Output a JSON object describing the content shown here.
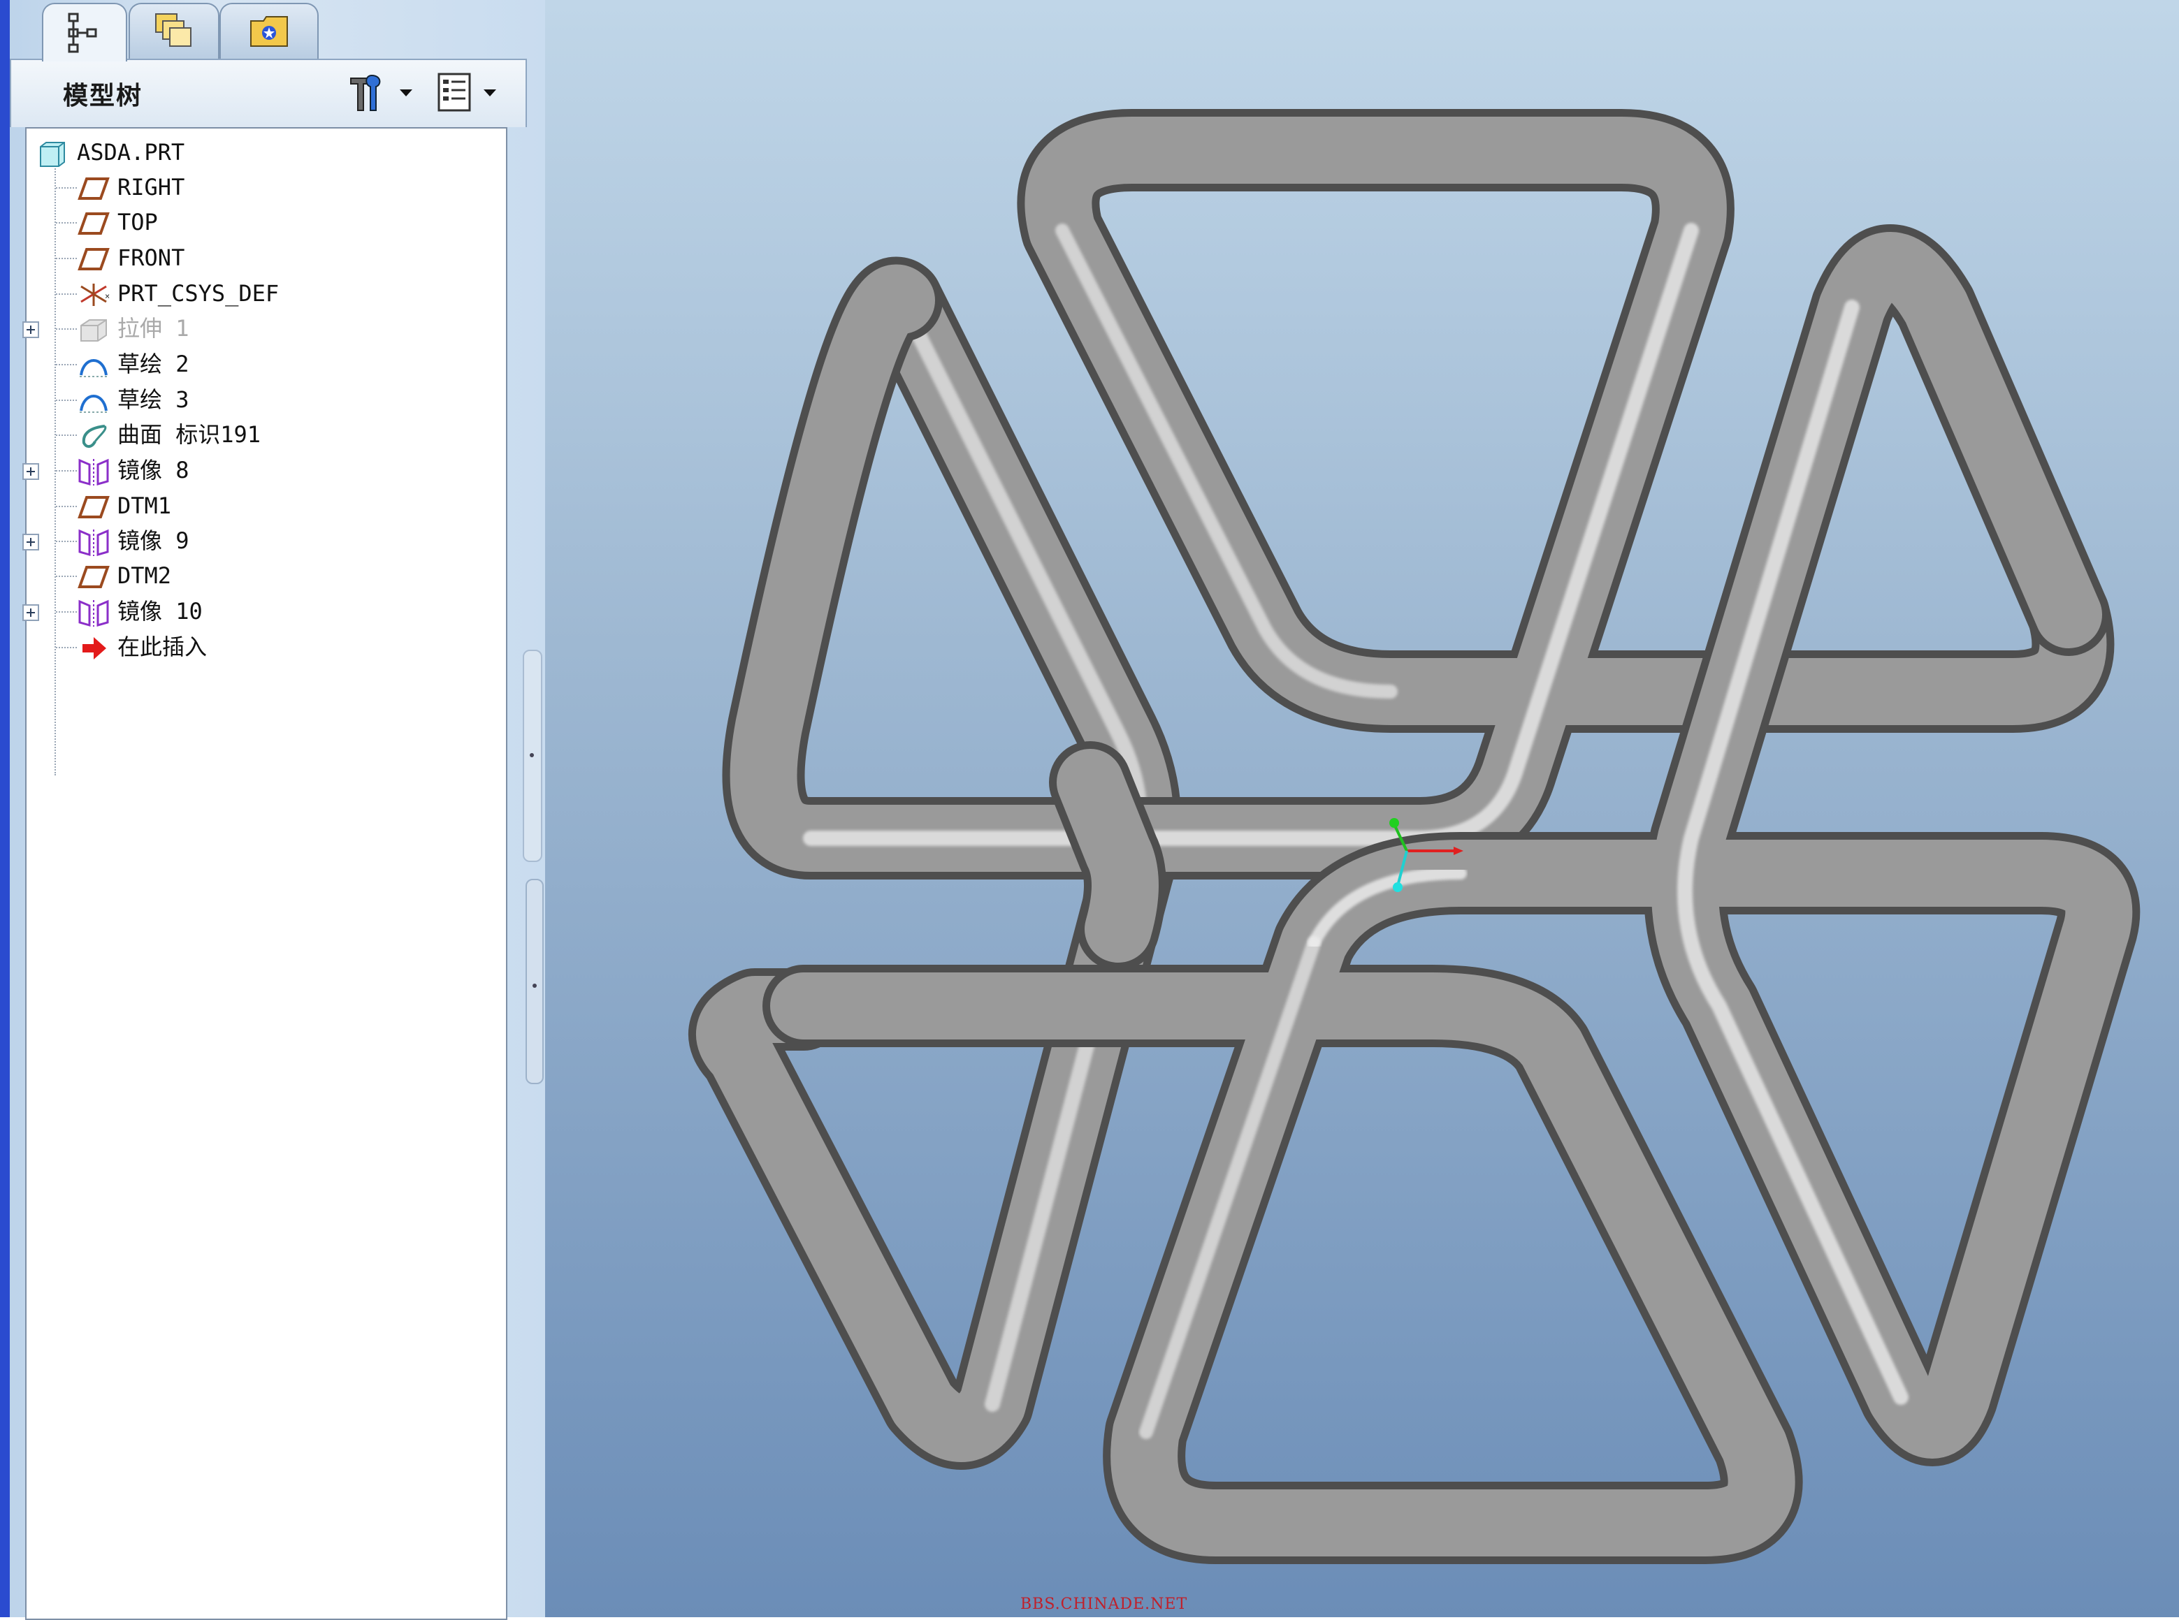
{
  "nav_tabs": [
    {
      "name": "model-tree-tab-icon",
      "active": true
    },
    {
      "name": "layers-tab-icon",
      "active": false
    },
    {
      "name": "favorites-folder-tab-icon",
      "active": false
    }
  ],
  "model_tree": {
    "title": "模型树",
    "settings_icon": "tools-icon",
    "show_icon": "tree-columns-icon",
    "items": [
      {
        "label": "ASDA.PRT",
        "icon": "part-icon"
      },
      {
        "label": "RIGHT",
        "icon": "datum-plane-icon"
      },
      {
        "label": "TOP",
        "icon": "datum-plane-icon"
      },
      {
        "label": "FRONT",
        "icon": "datum-plane-icon"
      },
      {
        "label": "PRT_CSYS_DEF",
        "icon": "coordinate-system-icon"
      },
      {
        "label": "拉伸 1",
        "icon": "extrude-icon",
        "expandable": true,
        "suppressed": true
      },
      {
        "label": "草绘 2",
        "icon": "sketch-icon"
      },
      {
        "label": "草绘 3",
        "icon": "sketch-icon"
      },
      {
        "label": "曲面 标识191",
        "icon": "surface-icon"
      },
      {
        "label": "镜像 8",
        "icon": "mirror-icon",
        "expandable": true
      },
      {
        "label": "DTM1",
        "icon": "datum-plane-icon"
      },
      {
        "label": "镜像 9",
        "icon": "mirror-icon",
        "expandable": true
      },
      {
        "label": "DTM2",
        "icon": "datum-plane-icon"
      },
      {
        "label": "镜像 10",
        "icon": "mirror-icon",
        "expandable": true
      },
      {
        "label": "在此插入",
        "icon": "insert-here-arrow-icon"
      }
    ]
  },
  "viewport": {
    "model_name": "interlocked-tube-knot",
    "watermark": "BBS.CHINADE.NET",
    "colors": {
      "tube": "#9a9a9a",
      "bg_top": "#c0d6e8",
      "bg_bottom": "#6b8db7",
      "axis_x": "#e02020",
      "axis_y": "#20c020",
      "axis_z": "#20d0d0"
    }
  }
}
